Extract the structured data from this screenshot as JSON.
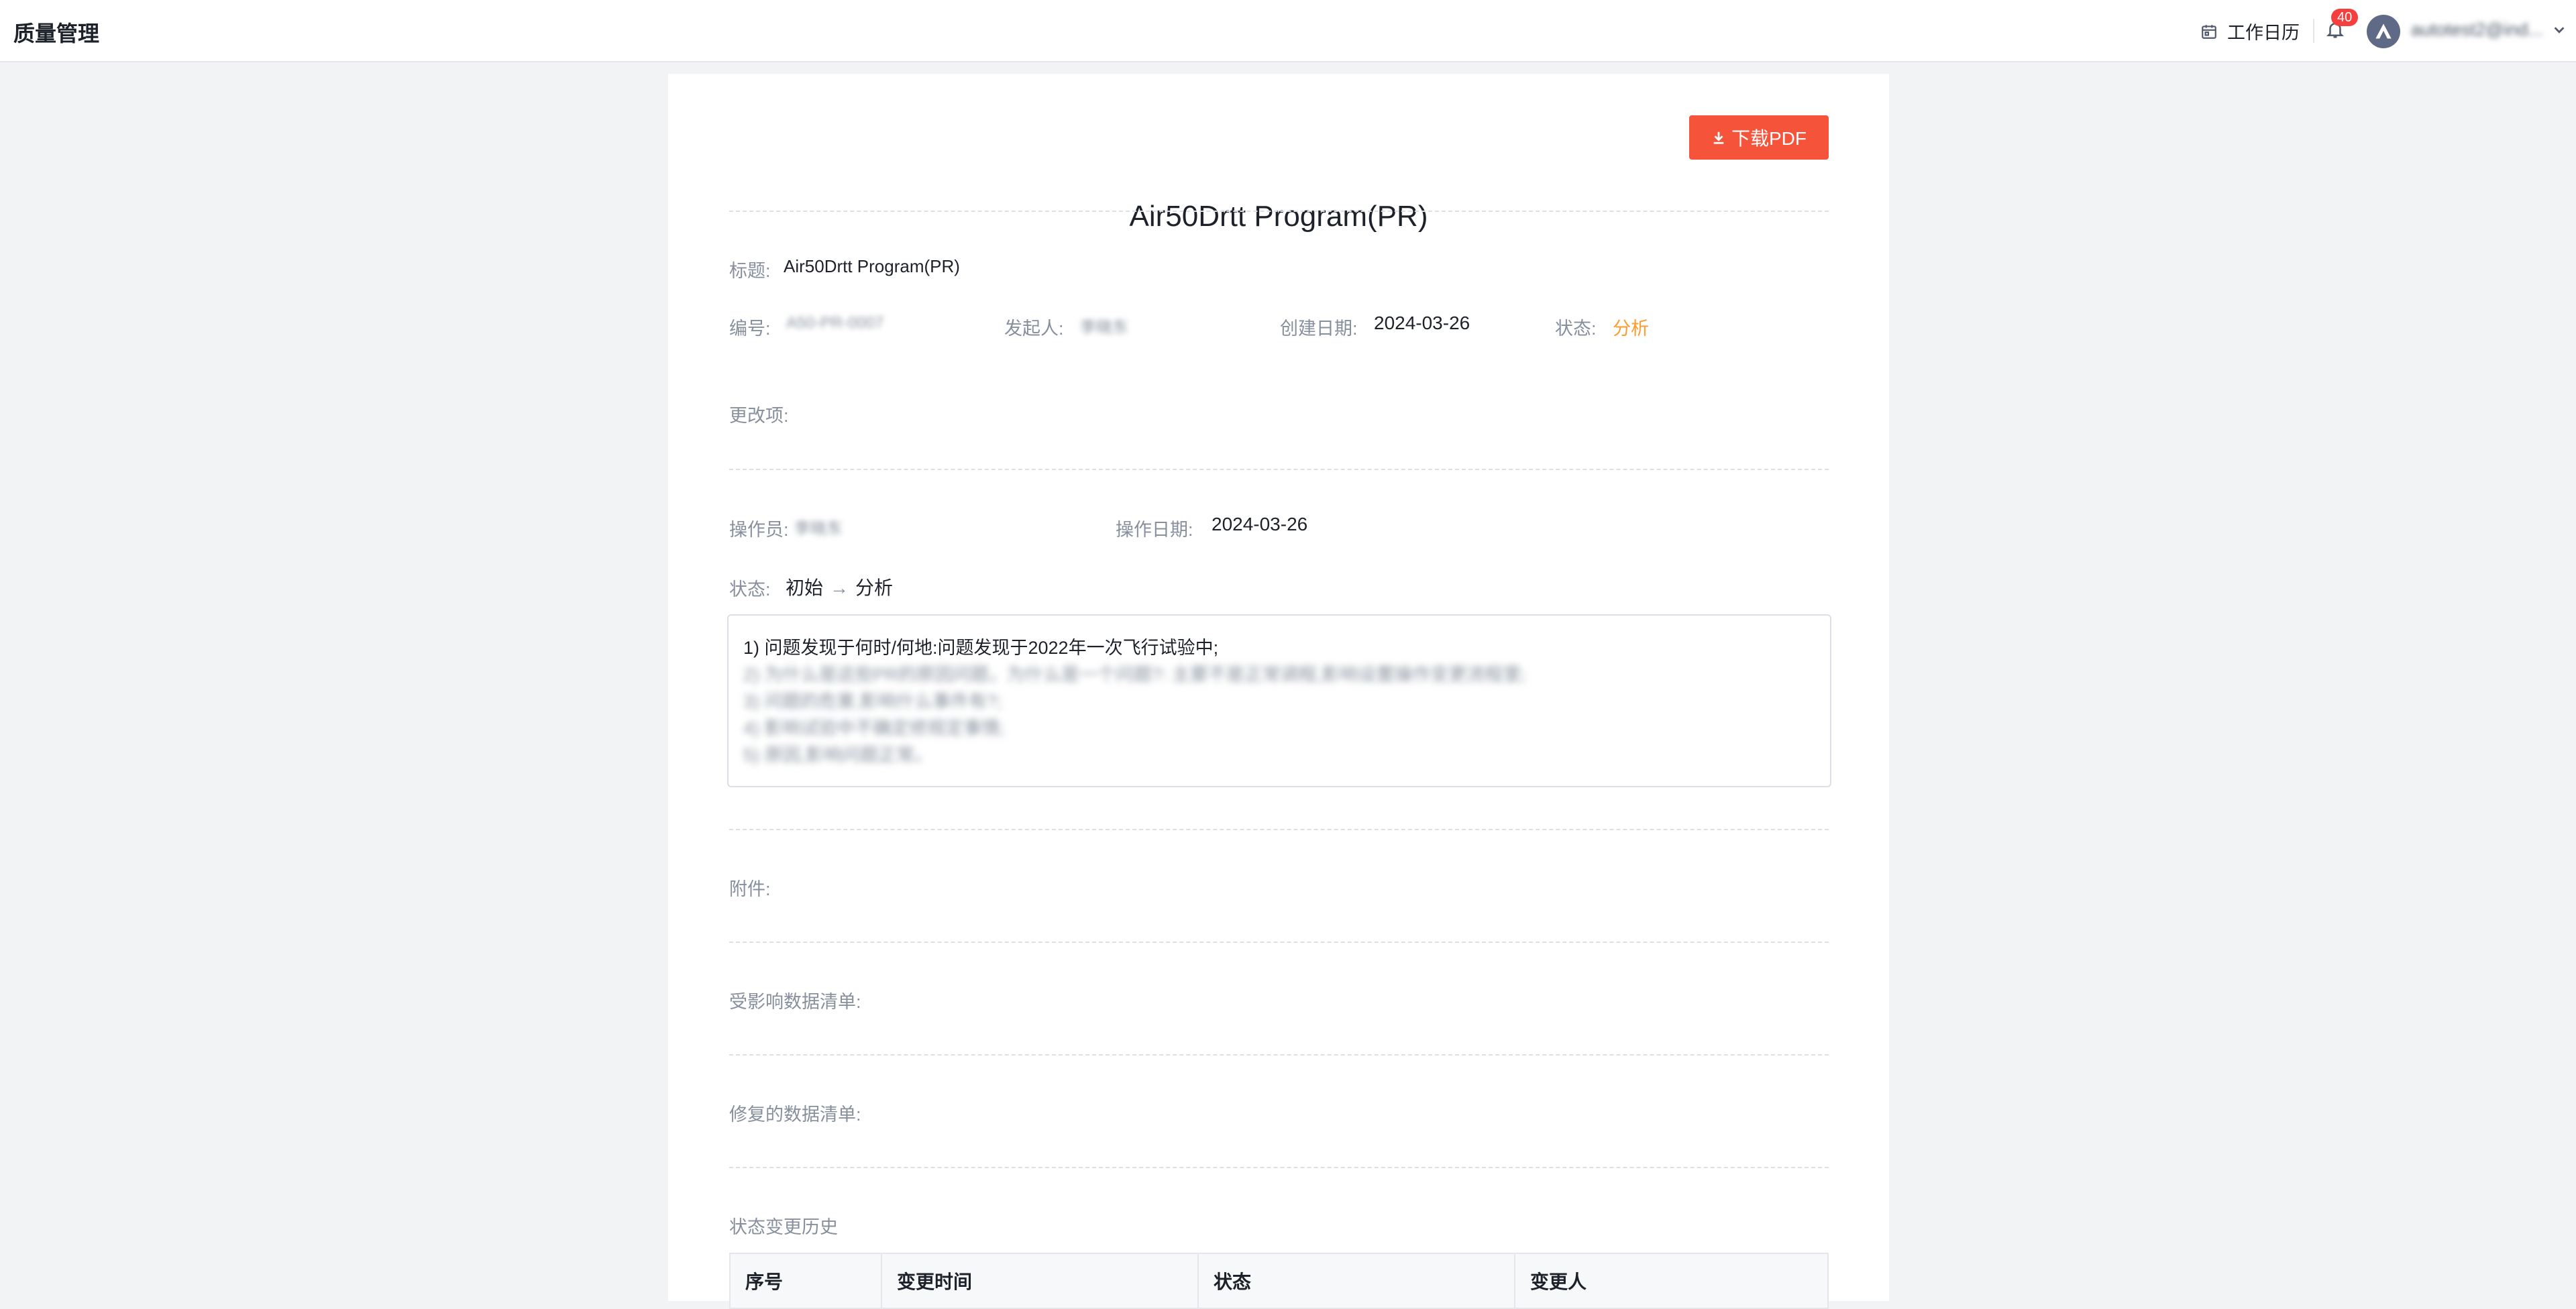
{
  "header": {
    "app_title": "质量管理",
    "calendar_label": "工作日历",
    "notification_count": "40",
    "user_name": "autotest2@ind..."
  },
  "document": {
    "title": "Air50Drtt Program(PR)",
    "download_label": "下载PDF",
    "fields": {
      "title_label": "标题:",
      "title_value": "Air50Drtt Program(PR)",
      "number_label": "编号:",
      "number_value": "A50-PR-0007",
      "initiator_label": "发起人:",
      "initiator_value": "李晓东",
      "created_label": "创建日期:",
      "created_value": "2024-03-26",
      "status_label": "状态:",
      "status_value": "分析",
      "changes_label": "更改项:"
    },
    "operation": {
      "operator_label": "操作员:",
      "operator_value": "李晓东",
      "op_date_label": "操作日期:",
      "op_date_value": "2024-03-26",
      "status_label": "状态:",
      "status_from": "初始",
      "status_arrow": "→",
      "status_to": "分析",
      "description_lines": [
        "1) 问题发现于何时/何地:问题发现于2022年一次飞行试验中;",
        "2) 为什么是这些PR的原因问题，为什么是一个问题?: 主要不是正常调程,影响设置操作变更流程里;",
        "3) 问题的危害,影响什么事件有?;",
        "4) 影响试验中不确定修规定事情;",
        "5) 原因,影响问题正常。"
      ]
    },
    "sections": {
      "attachments_label": "附件:",
      "affected_list_label": "受影响数据清单:",
      "repaired_list_label": "修复的数据清单:",
      "history_label": "状态变更历史"
    },
    "history_table": {
      "columns": [
        "序号",
        "变更时间",
        "状态",
        "变更人"
      ]
    }
  },
  "colors": {
    "accent": "#f5543b",
    "status_orange": "#ff9a2e",
    "badge_red": "#f53f3f"
  }
}
